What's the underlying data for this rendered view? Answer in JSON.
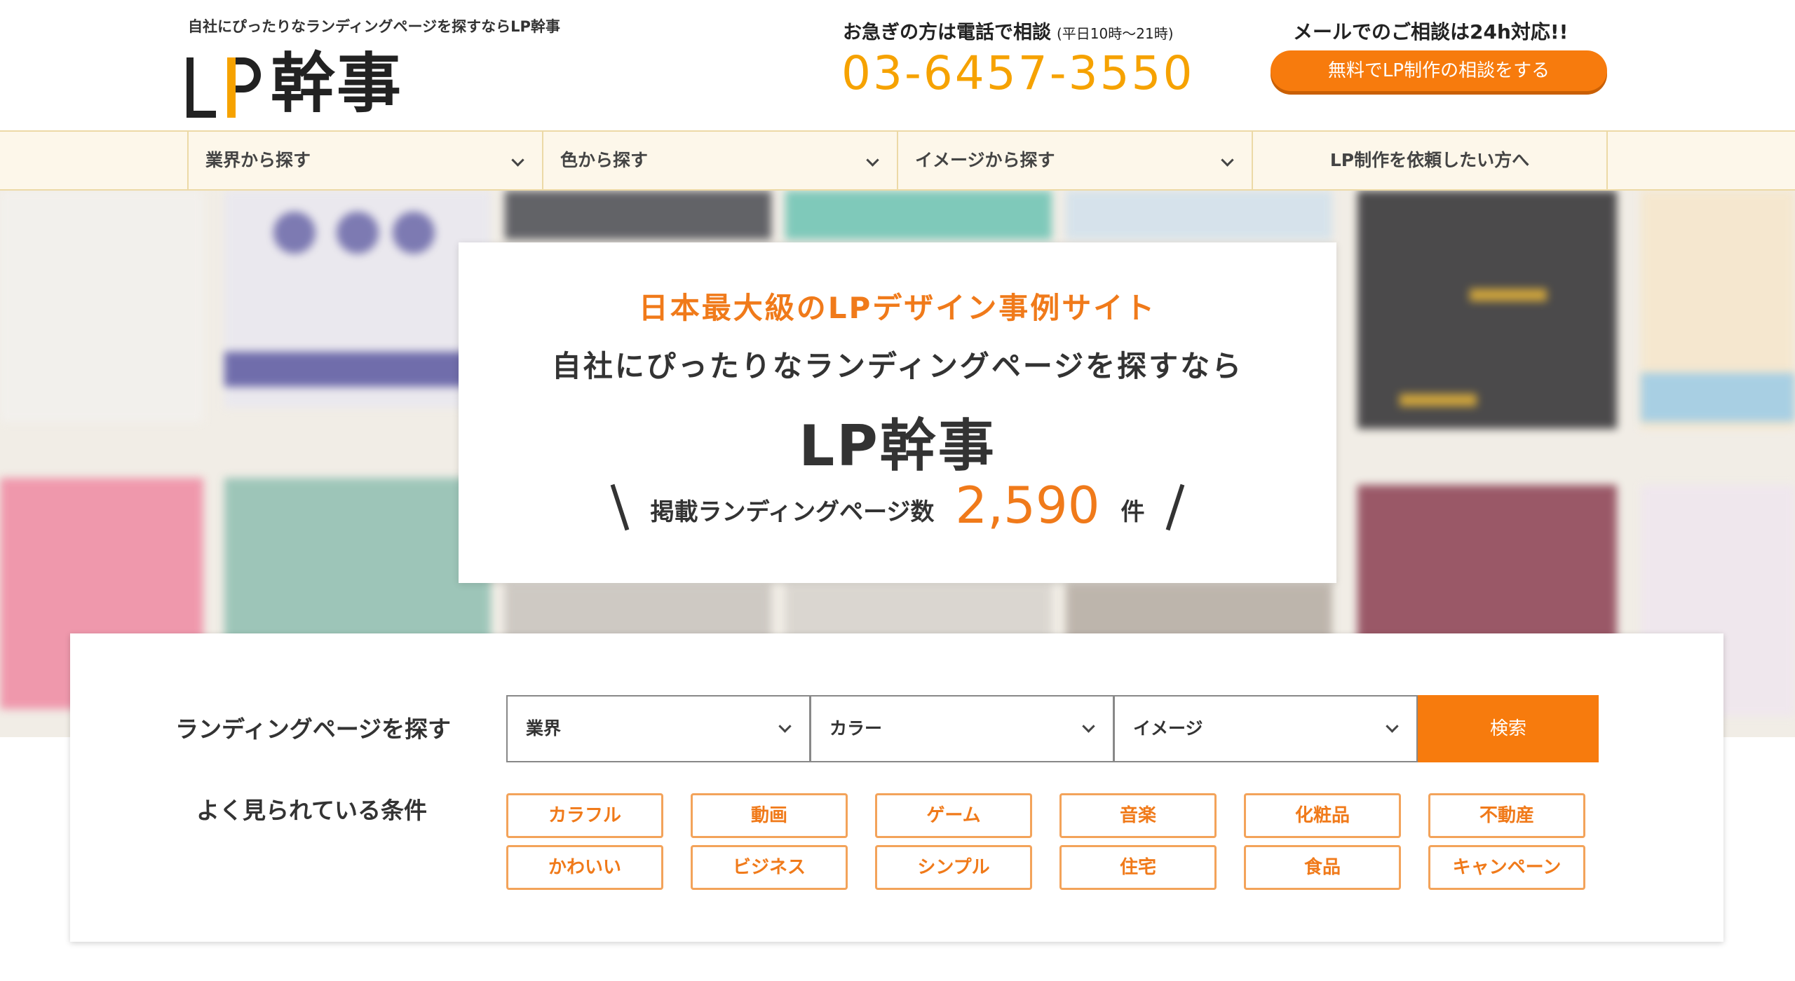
{
  "header": {
    "tagline": "自社にぴったりなランディングページを探すならLP幹事",
    "logo_text": "幹事",
    "tel_title": "お急ぎの方は電話で相談",
    "tel_hours": "(平日10時〜21時)",
    "tel_number": "03-6457-3550",
    "mail_title": "メールでのご相談は24h対応!!",
    "mail_button": "無料でLP制作の相談をする"
  },
  "nav": {
    "items": [
      {
        "label": "業界から探す"
      },
      {
        "label": "色から探す"
      },
      {
        "label": "イメージから探す"
      },
      {
        "label": "LP制作を依頼したい方へ"
      }
    ]
  },
  "hero": {
    "lead": "日本最大級のLPデザイン事例サイト",
    "sub": "自社にぴったりなランディングページを探すなら",
    "brand": "LP幹事",
    "count_label": "掲載ランディングページ数",
    "count": "2,590",
    "count_unit": "件"
  },
  "search": {
    "label": "ランディングページを探す",
    "selects": [
      {
        "value": "業界"
      },
      {
        "value": "カラー"
      },
      {
        "value": "イメージ"
      }
    ],
    "button": "検索",
    "popular_label": "よく見られている条件",
    "tags": [
      "カラフル",
      "動画",
      "ゲーム",
      "音楽",
      "化粧品",
      "不動産",
      "かわいい",
      "ビジネス",
      "シンプル",
      "住宅",
      "食品",
      "キャンペーン"
    ]
  },
  "colors": {
    "accent": "#f77b0d",
    "brand_yellow": "#f6a200",
    "nav_bg": "#fdf7ea"
  }
}
